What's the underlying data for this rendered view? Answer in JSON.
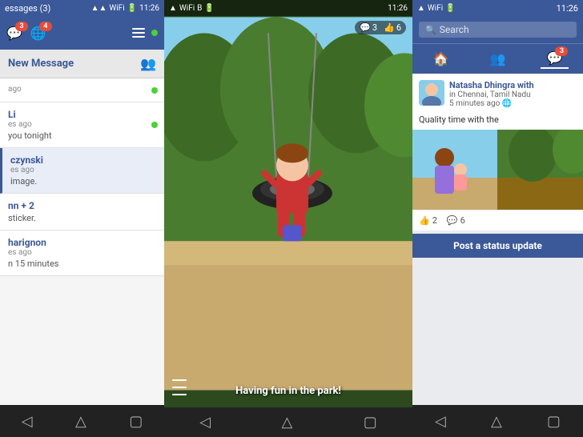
{
  "left": {
    "status_bar": {
      "title": "essages (3)",
      "time": "11:26",
      "online_indicator": "●"
    },
    "header": {
      "messages_badge": "3",
      "globe_badge": "4"
    },
    "new_message": {
      "label": "New Message"
    },
    "messages": [
      {
        "sender": "",
        "time": "ago",
        "preview": "",
        "online": true
      },
      {
        "sender": "Li",
        "time": "es ago",
        "preview": "you tonight",
        "online": true
      },
      {
        "sender": "czynski",
        "time": "es ago",
        "preview": "image.",
        "online": false
      },
      {
        "sender": "nn + 2",
        "time": "",
        "preview": "sticker.",
        "online": false
      },
      {
        "sender": "harignon",
        "time": "es ago",
        "preview": "n 15 minutes",
        "online": false
      }
    ],
    "nav": {
      "back": "⌂",
      "square": "▭",
      "home": "△"
    }
  },
  "middle": {
    "status_bar": {
      "time": "11:26"
    },
    "stats": {
      "comments": "3",
      "likes": "6"
    },
    "caption": "Having fun in the park!",
    "nav": {
      "back": "←",
      "home": "⌂",
      "square": "▭"
    }
  },
  "right": {
    "status_bar": {
      "time": "11:26"
    },
    "search": {
      "placeholder": "Search"
    },
    "tabs": {
      "news_badge": "",
      "friends_badge": "",
      "messages_badge": "3"
    },
    "post": {
      "author": "Natasha Dhingra",
      "author_suffix": " with",
      "location": "in Chennai, Tamil Nadu",
      "time": "5 minutes ago",
      "text": "Quality time with the",
      "likes": "2",
      "comments": "6"
    },
    "status_update": "Post a status update",
    "nav": {
      "back": "←",
      "home": "⌂",
      "square": "▭"
    }
  }
}
